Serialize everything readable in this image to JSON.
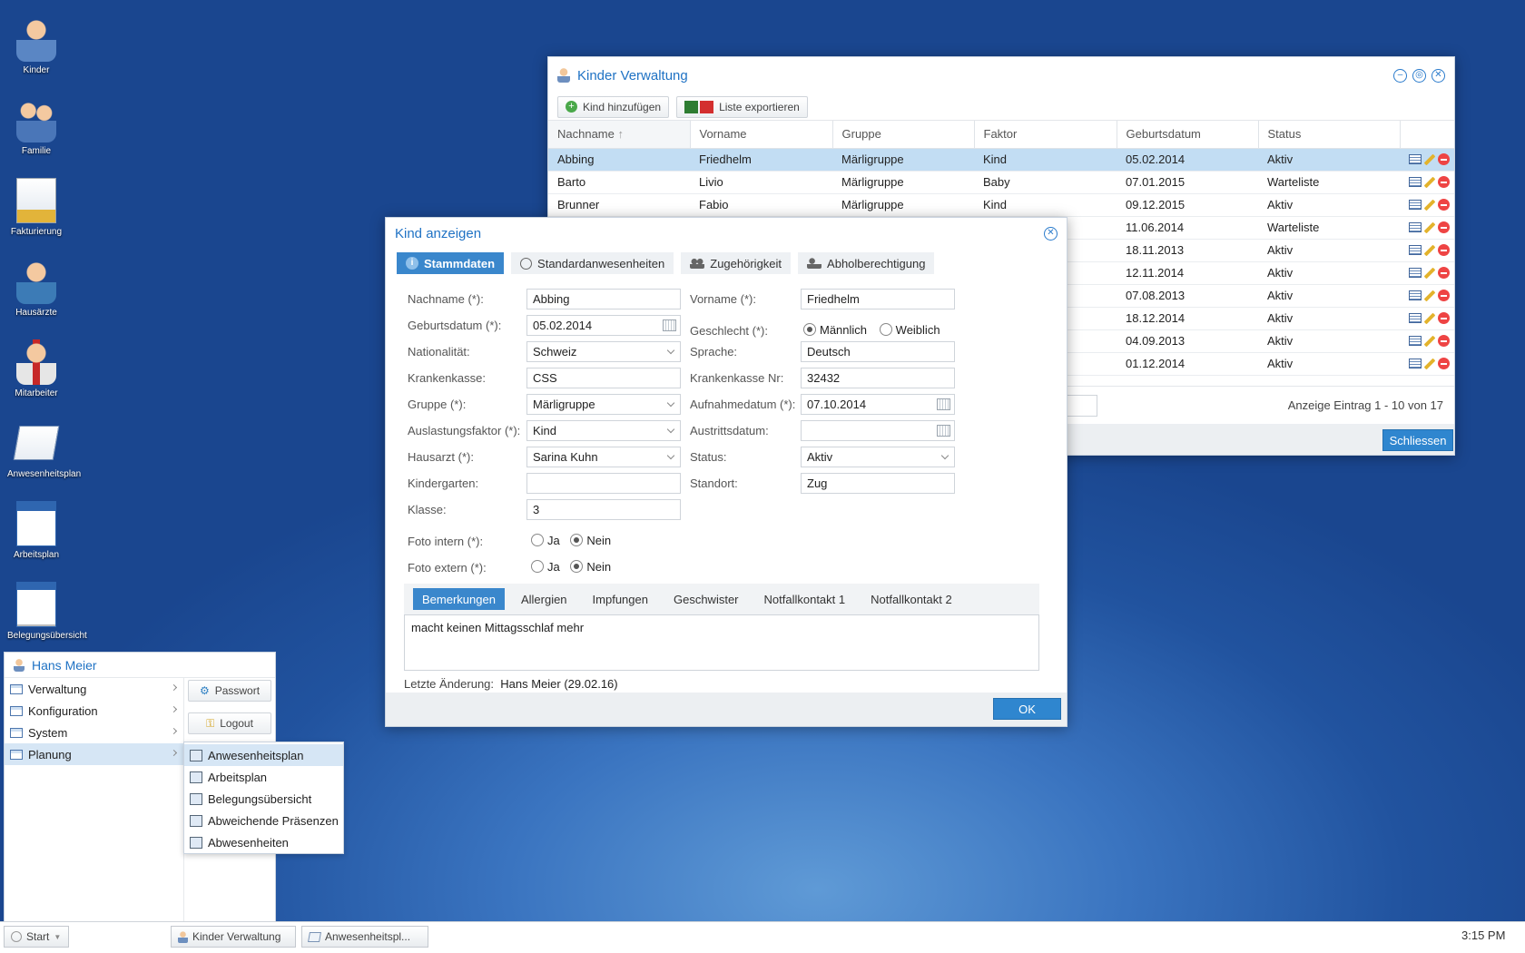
{
  "desktop_icons": [
    {
      "label": "Kinder",
      "icon": "child-icon"
    },
    {
      "label": "Familie",
      "icon": "family-icon"
    },
    {
      "label": "Fakturierung",
      "icon": "invoice-icon"
    },
    {
      "label": "Hausärzte",
      "icon": "doctor-icon"
    },
    {
      "label": "Mitarbeiter",
      "icon": "employee-icon"
    },
    {
      "label": "Anwesenheitsplan",
      "icon": "notepad-icon"
    },
    {
      "label": "Arbeitsplan",
      "icon": "workplan-icon"
    },
    {
      "label": "Belegungsübersicht",
      "icon": "calendar-icon"
    }
  ],
  "kinder_window": {
    "title": "Kinder Verwaltung",
    "toolbar": {
      "add": "Kind hinzufügen",
      "export": "Liste exportieren"
    },
    "columns": [
      "Nachname",
      "Vorname",
      "Gruppe",
      "Faktor",
      "Geburtsdatum",
      "Status"
    ],
    "sort_indicator": "↑",
    "rows": [
      {
        "nachname": "Abbing",
        "vorname": "Friedhelm",
        "gruppe": "Märligruppe",
        "faktor": "Kind",
        "geburtsdatum": "05.02.2014",
        "status": "Aktiv"
      },
      {
        "nachname": "Barto",
        "vorname": "Livio",
        "gruppe": "Märligruppe",
        "faktor": "Baby",
        "geburtsdatum": "07.01.2015",
        "status": "Warteliste"
      },
      {
        "nachname": "Brunner",
        "vorname": "Fabio",
        "gruppe": "Märligruppe",
        "faktor": "Kind",
        "geburtsdatum": "09.12.2015",
        "status": "Aktiv"
      },
      {
        "nachname": "",
        "vorname": "",
        "gruppe": "",
        "faktor": "",
        "geburtsdatum": "11.06.2014",
        "status": "Warteliste"
      },
      {
        "nachname": "",
        "vorname": "",
        "gruppe": "",
        "faktor": "",
        "geburtsdatum": "18.11.2013",
        "status": "Aktiv"
      },
      {
        "nachname": "",
        "vorname": "",
        "gruppe": "",
        "faktor": "",
        "geburtsdatum": "12.11.2014",
        "status": "Aktiv"
      },
      {
        "nachname": "",
        "vorname": "",
        "gruppe": "",
        "faktor": "",
        "geburtsdatum": "07.08.2013",
        "status": "Aktiv"
      },
      {
        "nachname": "",
        "vorname": "",
        "gruppe": "",
        "faktor": "",
        "geburtsdatum": "18.12.2014",
        "status": "Aktiv"
      },
      {
        "nachname": "",
        "vorname": "",
        "gruppe": "",
        "faktor": "",
        "geburtsdatum": "04.09.2013",
        "status": "Aktiv"
      },
      {
        "nachname": "",
        "vorname": "",
        "gruppe": "",
        "faktor": "",
        "geburtsdatum": "01.12.2014",
        "status": "Aktiv"
      }
    ],
    "paging_info": "Anzeige Eintrag 1 - 10 von 17",
    "close_button": "Schliessen"
  },
  "dialog": {
    "title": "Kind anzeigen",
    "tabs": [
      "Stammdaten",
      "Standardanwesenheiten",
      "Zugehörigkeit",
      "Abholberechtigung"
    ],
    "left": [
      {
        "label": "Nachname (*):",
        "value": "Abbing"
      },
      {
        "label": "Geburtsdatum (*):",
        "value": "05.02.2014"
      },
      {
        "label": "Nationalität:",
        "value": "Schweiz"
      },
      {
        "label": "Krankenkasse:",
        "value": "CSS"
      },
      {
        "label": "Gruppe (*):",
        "value": "Märligruppe"
      },
      {
        "label": "Auslastungsfaktor (*):",
        "value": "Kind"
      },
      {
        "label": "Hausarzt (*):",
        "value": "Sarina Kuhn"
      },
      {
        "label": "Kindergarten:",
        "value": ""
      },
      {
        "label": "Klasse:",
        "value": "3"
      }
    ],
    "right": [
      {
        "label": "Vorname (*):",
        "value": "Friedhelm"
      },
      {
        "label": "Geschlecht (*):",
        "value": ""
      },
      {
        "label": "Sprache:",
        "value": "Deutsch"
      },
      {
        "label": "Krankenkasse Nr:",
        "value": "32432"
      },
      {
        "label": "Aufnahmedatum (*):",
        "value": "07.10.2014"
      },
      {
        "label": "Austrittsdatum:",
        "value": ""
      },
      {
        "label": "Status:",
        "value": "Aktiv"
      },
      {
        "label": "Standort:",
        "value": "Zug"
      }
    ],
    "gender": {
      "male": "Männlich",
      "female": "Weiblich",
      "selected": "male"
    },
    "foto_intern": {
      "label": "Foto intern (*):",
      "yes": "Ja",
      "no": "Nein",
      "selected": "no"
    },
    "foto_extern": {
      "label": "Foto extern (*):",
      "yes": "Ja",
      "no": "Nein",
      "selected": "no"
    },
    "subtabs": [
      "Bemerkungen",
      "Allergien",
      "Impfungen",
      "Geschwister",
      "Notfallkontakt 1",
      "Notfallkontakt 2"
    ],
    "remark": "macht keinen Mittagsschlaf mehr",
    "last_change_label": "Letzte Änderung:",
    "last_change_value": "Hans Meier (29.02.16)",
    "ok": "OK"
  },
  "start_menu": {
    "user": "Hans Meier",
    "items": [
      "Verwaltung",
      "Konfiguration",
      "System",
      "Planung"
    ],
    "password": "Passwort",
    "logout": "Logout",
    "submenu": [
      "Anwesenheitsplan",
      "Arbeitsplan",
      "Belegungsübersicht",
      "Abweichende Präsenzen",
      "Abwesenheiten"
    ]
  },
  "taskbar": {
    "start": "Start",
    "tasks": [
      "Kinder Verwaltung",
      "Anwesenheitspl..."
    ],
    "clock": "3:15 PM"
  }
}
